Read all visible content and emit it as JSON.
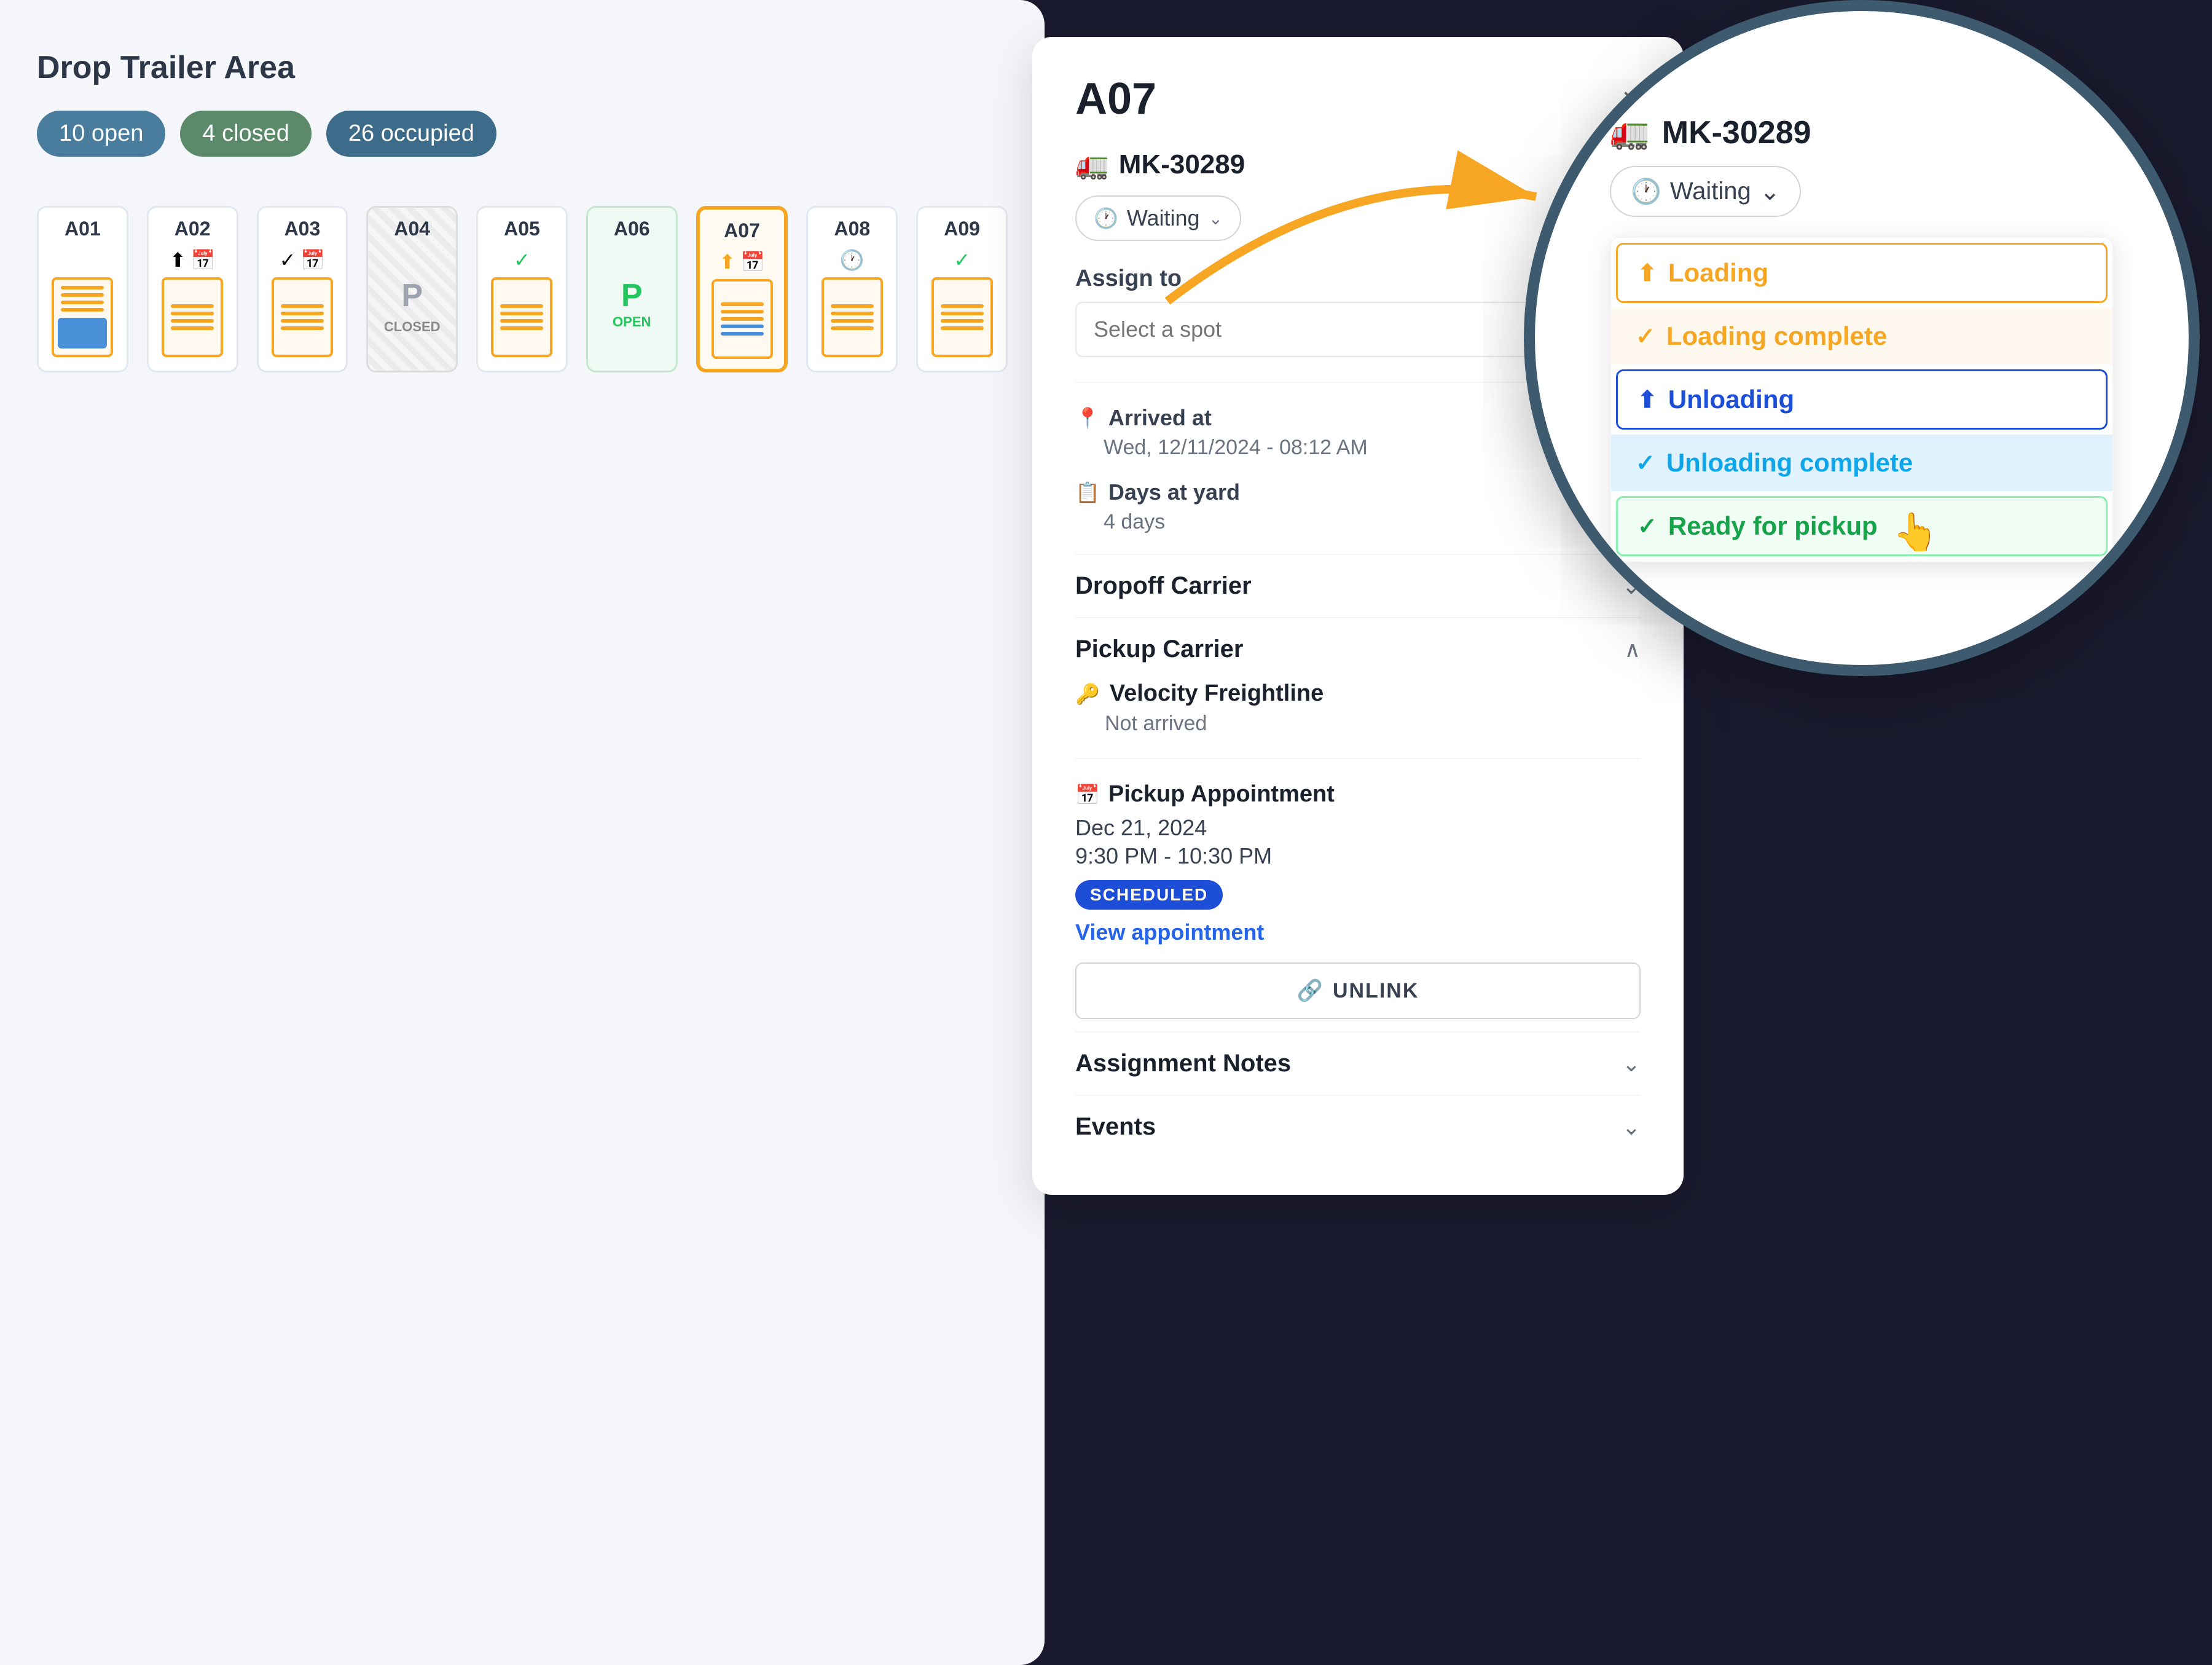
{
  "yard": {
    "title": "Drop Trailer Area",
    "badges": [
      {
        "id": "open",
        "label": "10 open",
        "class": "badge-open"
      },
      {
        "id": "closed",
        "label": "4 closed",
        "class": "badge-closed"
      },
      {
        "id": "occupied",
        "label": "26 occupied",
        "class": "badge-occupied"
      }
    ],
    "spots": [
      {
        "id": "A01",
        "label": "A01",
        "type": "occupied",
        "icons": []
      },
      {
        "id": "A02",
        "label": "A02",
        "type": "occupied",
        "icons": [
          "unload",
          "calendar"
        ]
      },
      {
        "id": "A03",
        "label": "A03",
        "type": "occupied",
        "icons": [
          "check",
          "calendar"
        ]
      },
      {
        "id": "A04",
        "label": "A04",
        "type": "closed",
        "icons": []
      },
      {
        "id": "A05",
        "label": "A05",
        "type": "occupied",
        "icons": [
          "check"
        ]
      },
      {
        "id": "A06",
        "label": "A06",
        "type": "open",
        "icons": []
      },
      {
        "id": "A07",
        "label": "A07",
        "type": "selected",
        "icons": [
          "unload",
          "calendar"
        ]
      },
      {
        "id": "A08",
        "label": "A08",
        "type": "occupied",
        "icons": [
          "clock"
        ]
      },
      {
        "id": "A09",
        "label": "A09",
        "type": "occupied",
        "icons": [
          "check"
        ]
      }
    ]
  },
  "detail_panel": {
    "title": "A07",
    "close_label": "×",
    "truck_icon": "🚛",
    "truck_id": "MK-30289",
    "status": {
      "label": "Waiting",
      "clock_icon": "🕐",
      "chevron": "⌄"
    },
    "assign": {
      "label": "Assign to",
      "placeholder": "Select a spot"
    },
    "arrived_at": {
      "label": "Arrived at",
      "icon": "📍",
      "value": "Wed, 12/11/2024 - 08:12 AM"
    },
    "days_at_yard": {
      "label": "Days at yard",
      "icon": "📋",
      "value": "4 days"
    },
    "dropoff_carrier": {
      "title": "Dropoff Carrier",
      "expanded": false
    },
    "pickup_carrier": {
      "title": "Pickup Carrier",
      "expanded": true,
      "carrier_icon": "🔑",
      "carrier_name": "Velocity Freightline",
      "status": "Not arrived",
      "appointment": {
        "label": "Pickup Appointment",
        "icon": "📅",
        "date": "Dec 21, 2024",
        "time": "9:30 PM - 10:30 PM",
        "badge": "SCHEDULED",
        "view_link": "View appointment"
      },
      "unlink_label": "UNLINK"
    },
    "assignment_notes": {
      "title": "Assignment Notes"
    },
    "events": {
      "title": "Events"
    }
  },
  "zoom_panel": {
    "truck_icon": "🚛",
    "truck_id": "MK-30289",
    "status_label": "Waiting",
    "clock_icon": "🕐",
    "chevron": "⌄",
    "menu_options": [
      {
        "id": "loading",
        "label": "Loading",
        "icon": "⬆",
        "class": "loading"
      },
      {
        "id": "loading-complete",
        "label": "Loading complete",
        "icon": "✓",
        "class": "loading-complete"
      },
      {
        "id": "unloading",
        "label": "Unloading",
        "icon": "⬆",
        "class": "unloading"
      },
      {
        "id": "unloading-complete",
        "label": "Unloading complete",
        "icon": "✓",
        "class": "unloading-complete"
      },
      {
        "id": "ready-for-pickup",
        "label": "Ready for pickup",
        "icon": "✓",
        "class": "ready-for-pickup"
      }
    ]
  },
  "colors": {
    "orange": "#f6a623",
    "blue": "#1d4ed8",
    "green": "#16a34a",
    "teal": "#3d5a6e"
  }
}
